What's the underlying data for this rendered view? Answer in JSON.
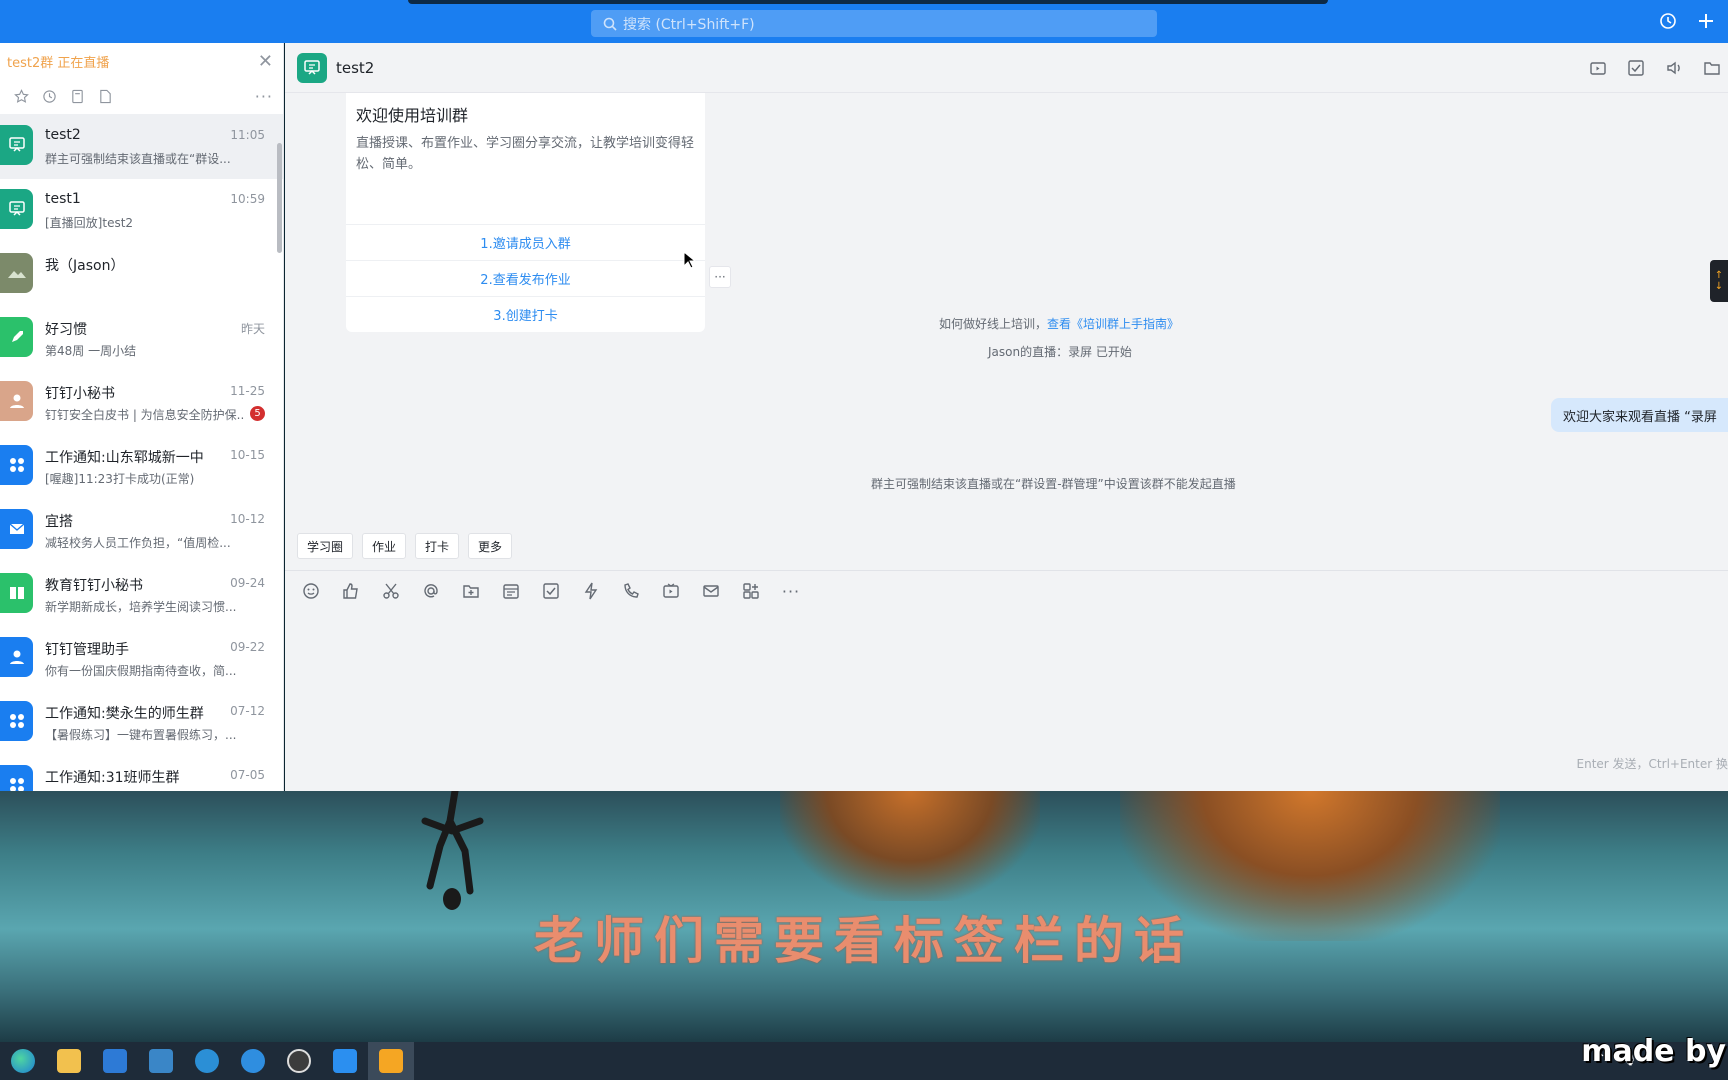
{
  "topbar": {
    "search_placeholder": "搜索 (Ctrl+Shift+F)",
    "icons": [
      "history-icon",
      "plus-icon"
    ]
  },
  "sidebar": {
    "live_banner": "test2群 正在直播",
    "more": "···",
    "conversations": [
      {
        "title": "test2",
        "time": "11:05",
        "sub": "群主可强制结束该直播或在“群设...",
        "avatar_color": "#1ba784",
        "active": true
      },
      {
        "title": "test1",
        "time": "10:59",
        "sub": "[直播回放]test2",
        "avatar_color": "#1ba784"
      },
      {
        "title": "我（Jason）",
        "time": "",
        "sub": "",
        "avatar_color": "#7c8a6a"
      },
      {
        "title": "好习惯",
        "time": "昨天",
        "sub": "第48周 一周小结",
        "avatar_color": "#2bc16b"
      },
      {
        "title": "钉钉小秘书",
        "time": "11-25",
        "sub": "钉钉安全白皮书 | 为信息安全防护保...",
        "avatar_color": "#d9a58a",
        "badge": "5"
      },
      {
        "title": "工作通知:山东郓城新一中",
        "time": "10-15",
        "sub": "[喔趣]11:23打卡成功(正常)",
        "avatar_color": "#1a7ef0"
      },
      {
        "title": "宜搭",
        "time": "10-12",
        "sub": "减轻校务人员工作负担，“值周检...",
        "avatar_color": "#1a7ef0"
      },
      {
        "title": "教育钉钉小秘书",
        "time": "09-24",
        "sub": "新学期新成长，培养学生阅读习惯...",
        "avatar_color": "#2bc16b"
      },
      {
        "title": "钉钉管理助手",
        "time": "09-22",
        "sub": "你有一份国庆假期指南待查收，简...",
        "avatar_color": "#1a7ef0"
      },
      {
        "title": "工作通知:樊永生的师生群",
        "time": "07-12",
        "sub": "【暑假练习】一键布置暑假练习，...",
        "avatar_color": "#1a7ef0"
      },
      {
        "title": "工作通知:31班师生群",
        "time": "07-05",
        "sub": "",
        "avatar_color": "#1a7ef0"
      }
    ]
  },
  "chat": {
    "title": "test2",
    "card": {
      "title": "欢迎使用培训群",
      "desc": "直播授课、布置作业、学习圈分享交流，让教学培训变得轻松、简单。",
      "links": [
        "1.邀请成员入群",
        "2.查看发布作业",
        "3.创建打卡"
      ],
      "more": "···"
    },
    "sys1_prefix": "如何做好线上培训，",
    "sys1_link": "查看《培训群上手指南》",
    "sys2": "Jason的直播：录屏 已开始",
    "bubble": "欢迎大家来观看直播 “录屏",
    "sys3": "群主可强制结束该直播或在“群设置-群管理”中设置该群不能发起直播",
    "app_tabs": [
      "学习圈",
      "作业",
      "打卡",
      "更多"
    ],
    "send_hint": "Enter 发送，Ctrl+Enter 换"
  },
  "video": {
    "subtitle": "老师们需要看标签栏的话"
  },
  "watermark": "made by",
  "colors": {
    "brand_blue": "#1a7ef0",
    "link": "#2d8cf0",
    "live_orange": "#f0a34d",
    "subtitle": "#e98d6e"
  }
}
